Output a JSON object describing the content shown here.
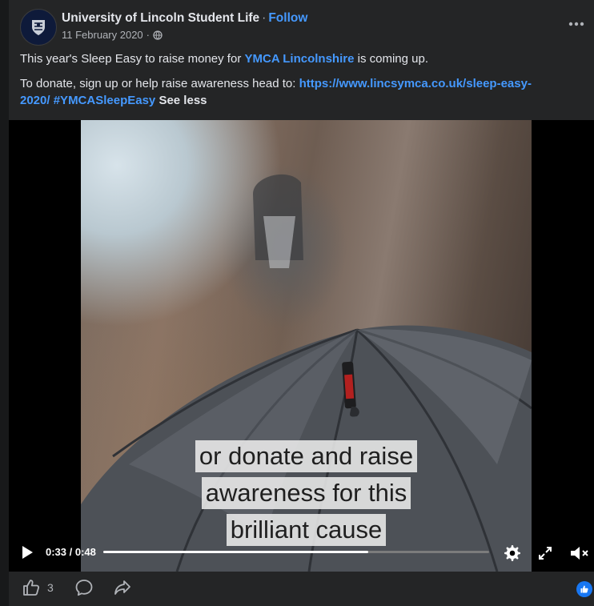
{
  "post": {
    "page_name": "University of Lincoln Student Life",
    "separator": "·",
    "follow_label": "Follow",
    "date": "11 February 2020",
    "date_separator": "·",
    "line1_before": "This year's Sleep Easy to raise money for ",
    "line1_link": "YMCA Lincolnshire",
    "line1_after": " is coming up.",
    "line2_before": "To donate, sign up or help raise awareness head to: ",
    "line2_link": "https://www.lincsymca.co.uk/sleep-easy-2020/",
    "line2_hashtag": "#YMCASleepEasy",
    "see_less": "See less"
  },
  "video": {
    "captions": [
      "or donate and raise",
      "awareness for this",
      "brilliant cause"
    ],
    "current_time": "0:33",
    "time_separator": " / ",
    "duration": "0:48",
    "progress_fraction": 0.6875
  },
  "actions": {
    "like_count": "3"
  },
  "icons": {
    "avatar": "university-crest-icon",
    "globe": "globe-icon",
    "more": "more-options-icon",
    "play": "play-icon",
    "settings": "gear-icon",
    "fullscreen": "fullscreen-icon",
    "mute": "muted-speaker-icon",
    "like": "thumbs-up-icon",
    "comment": "comment-icon",
    "share": "share-icon"
  },
  "colors": {
    "link": "#4599ff",
    "background": "#242526",
    "like_badge": "#1877f2"
  }
}
